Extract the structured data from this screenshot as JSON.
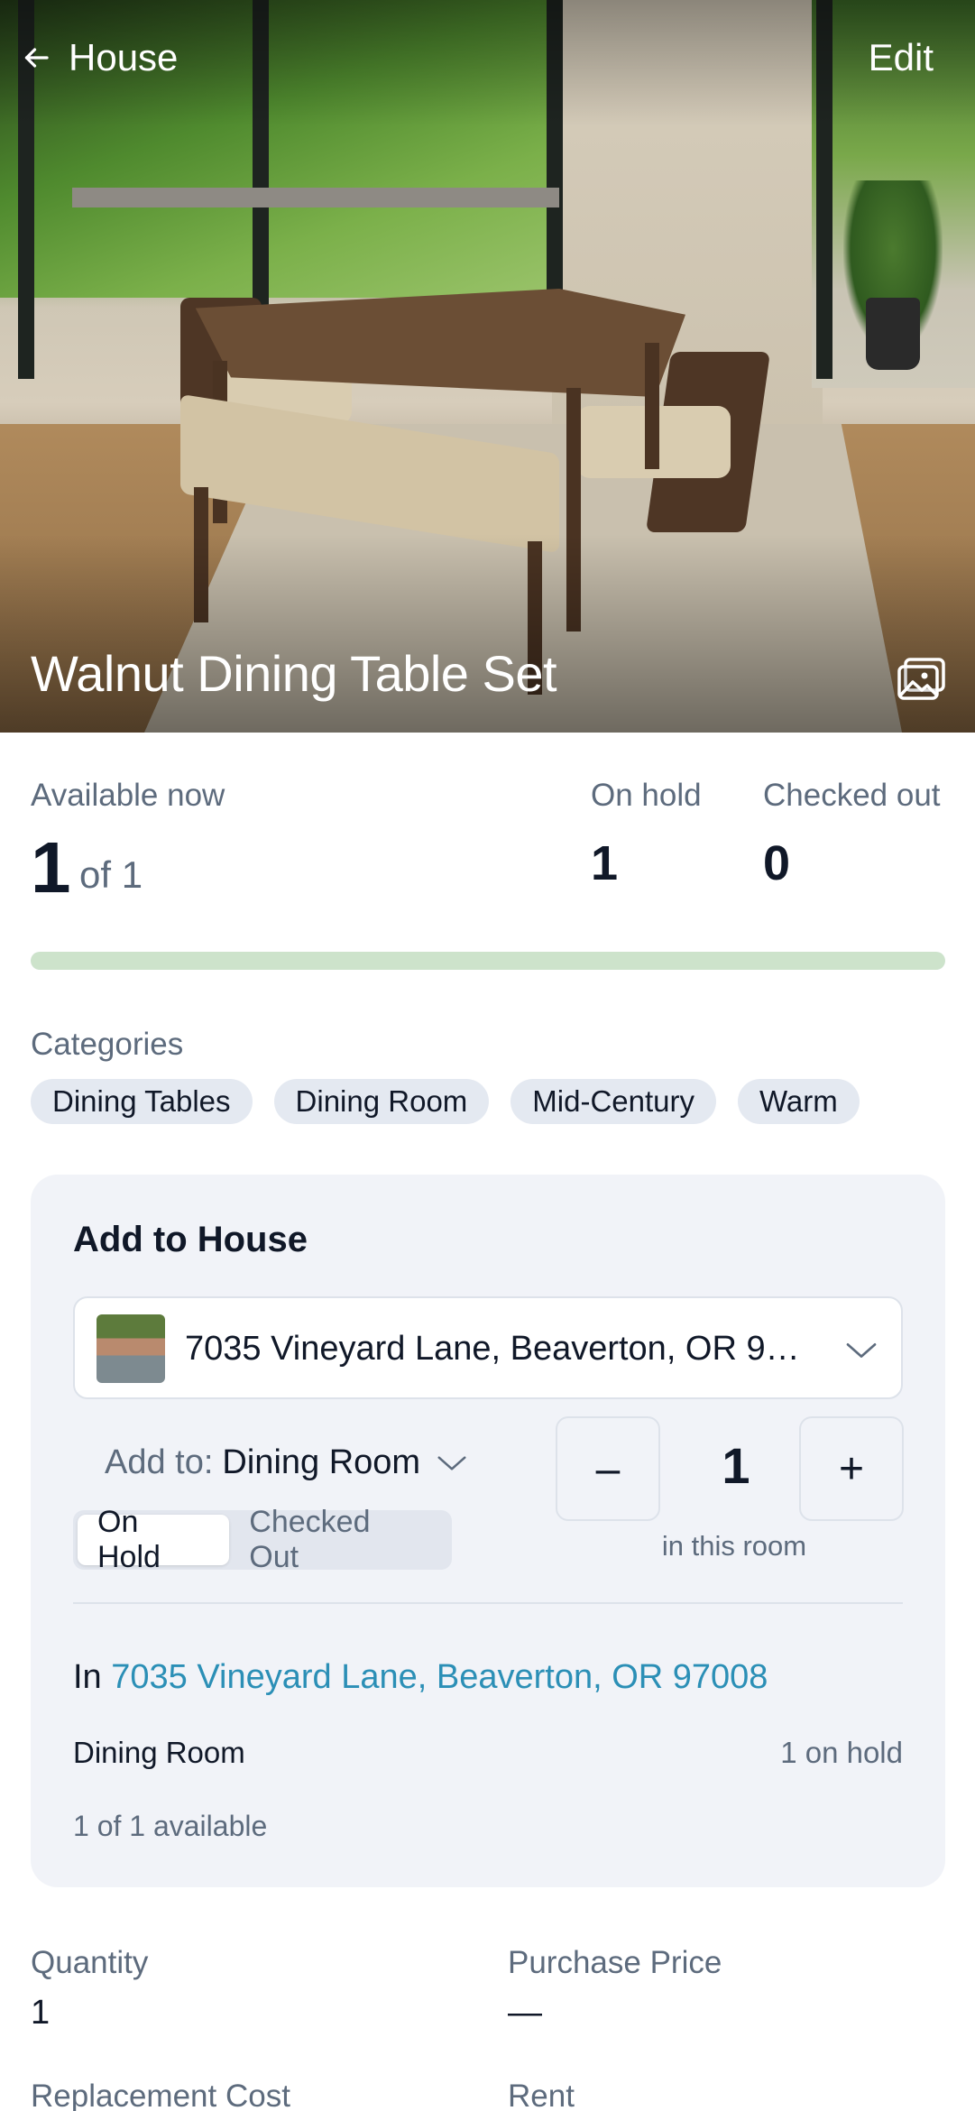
{
  "header": {
    "back_label": "House",
    "edit_label": "Edit"
  },
  "item": {
    "title": "Walnut Dining Table Set"
  },
  "stats": {
    "available_label": "Available now",
    "available_count": "1",
    "available_of": "of 1",
    "on_hold_label": "On hold",
    "on_hold_value": "1",
    "checked_out_label": "Checked out",
    "checked_out_value": "0",
    "availability_fraction": 1.0
  },
  "categories": {
    "label": "Categories",
    "items": [
      "Dining Tables",
      "Dining Room",
      "Mid-Century",
      "Warm"
    ]
  },
  "add_card": {
    "title": "Add to House",
    "house_selected": "7035 Vineyard Lane, Beaverton, OR 9…",
    "add_to_prefix": "Add to:",
    "add_to_room": "Dining Room",
    "status_options": [
      "On Hold",
      "Checked Out"
    ],
    "status_selected": "On Hold",
    "decrement_label": "–",
    "increment_label": "+",
    "quantity": "1",
    "quantity_label": "in this room",
    "in_prefix": "In",
    "in_address": "7035 Vineyard Lane, Beaverton, OR 97008",
    "room_name": "Dining Room",
    "room_status": "1 on hold",
    "availability": "1 of 1 available"
  },
  "details": {
    "quantity_label": "Quantity",
    "quantity_value": "1",
    "purchase_price_label": "Purchase Price",
    "purchase_price_value": "—",
    "replacement_cost_label": "Replacement Cost",
    "rent_label": "Rent"
  },
  "colors": {
    "accent_link": "#2b8fb6",
    "availability_bar": "#cde3cb",
    "chip_bg": "#e4e9f1",
    "card_bg": "#f1f3f8"
  }
}
